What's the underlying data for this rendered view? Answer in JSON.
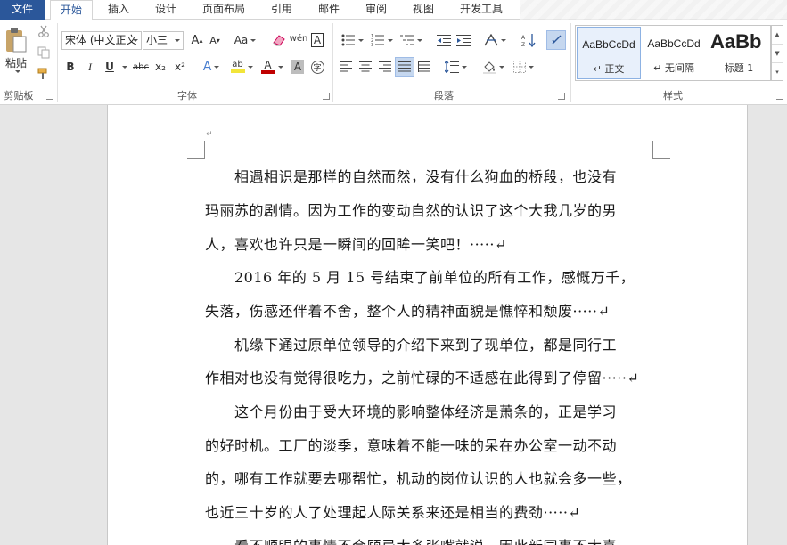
{
  "tabs": {
    "file": "文件",
    "home": "开始",
    "insert": "插入",
    "design": "设计",
    "layout": "页面布局",
    "references": "引用",
    "mailings": "邮件",
    "review": "审阅",
    "view": "视图",
    "developer": "开发工具"
  },
  "clipboard": {
    "paste": "粘贴",
    "group": "剪贴板"
  },
  "font": {
    "name": "宋体 (中文正文",
    "size": "小三",
    "case_label": "Aa",
    "group": "字体",
    "bold": "B",
    "italic": "I",
    "underline": "U",
    "strike": "abc",
    "subscript": "x₂",
    "superscript": "x²",
    "grow": "A",
    "shrink": "A",
    "phonetic": "wén",
    "border_char": "A",
    "effects": "A",
    "shade": "A",
    "enclose": "字",
    "highlight": "ab",
    "color_letter": "A",
    "colors": {
      "highlight": "#f2e53a",
      "font": "#c00000"
    }
  },
  "paragraph": {
    "group": "段落"
  },
  "styles": {
    "group": "样式",
    "items": [
      {
        "sample": "AaBbCcDd",
        "name": "↵ 正文"
      },
      {
        "sample": "AaBbCcDd",
        "name": "↵ 无间隔"
      },
      {
        "sample": "AaBb",
        "name": "标题 1"
      }
    ]
  },
  "document": {
    "marker": "↵",
    "lines": [
      "　　相遇相识是那样的自然而然，没有什么狗血的桥段，也没有",
      "玛丽苏的剧情。因为工作的变动自然的认识了这个大我几岁的男",
      "人，喜欢也许只是一瞬间的回眸一笑吧！·····↵",
      "　　2016 年的 5 月 15 号结束了前单位的所有工作，感慨万千，",
      "失落，伤感还伴着不舍，整个人的精神面貌是憔悴和颓废·····↵",
      "　　机缘下通过原单位领导的介绍下来到了现单位，都是同行工",
      "作相对也没有觉得很吃力，之前忙碌的不适感在此得到了停留·····↵",
      "　　这个月份由于受大环境的影响整体经济是萧条的，正是学习",
      "的好时机。工厂的淡季，意味着不能一味的呆在办公室一动不动",
      "的，哪有工作就要去哪帮忙，机动的岗位认识的人也就会多一些，",
      "也近三十岁的人了处理起人际关系来还是相当的费劲·····↵",
      "　　看不顺眼的事情不会顾忌太多张嘴就说，因此新同事不太喜"
    ]
  },
  "colors": {
    "file_tab": "#2b579a",
    "accent": "#2b579a"
  }
}
